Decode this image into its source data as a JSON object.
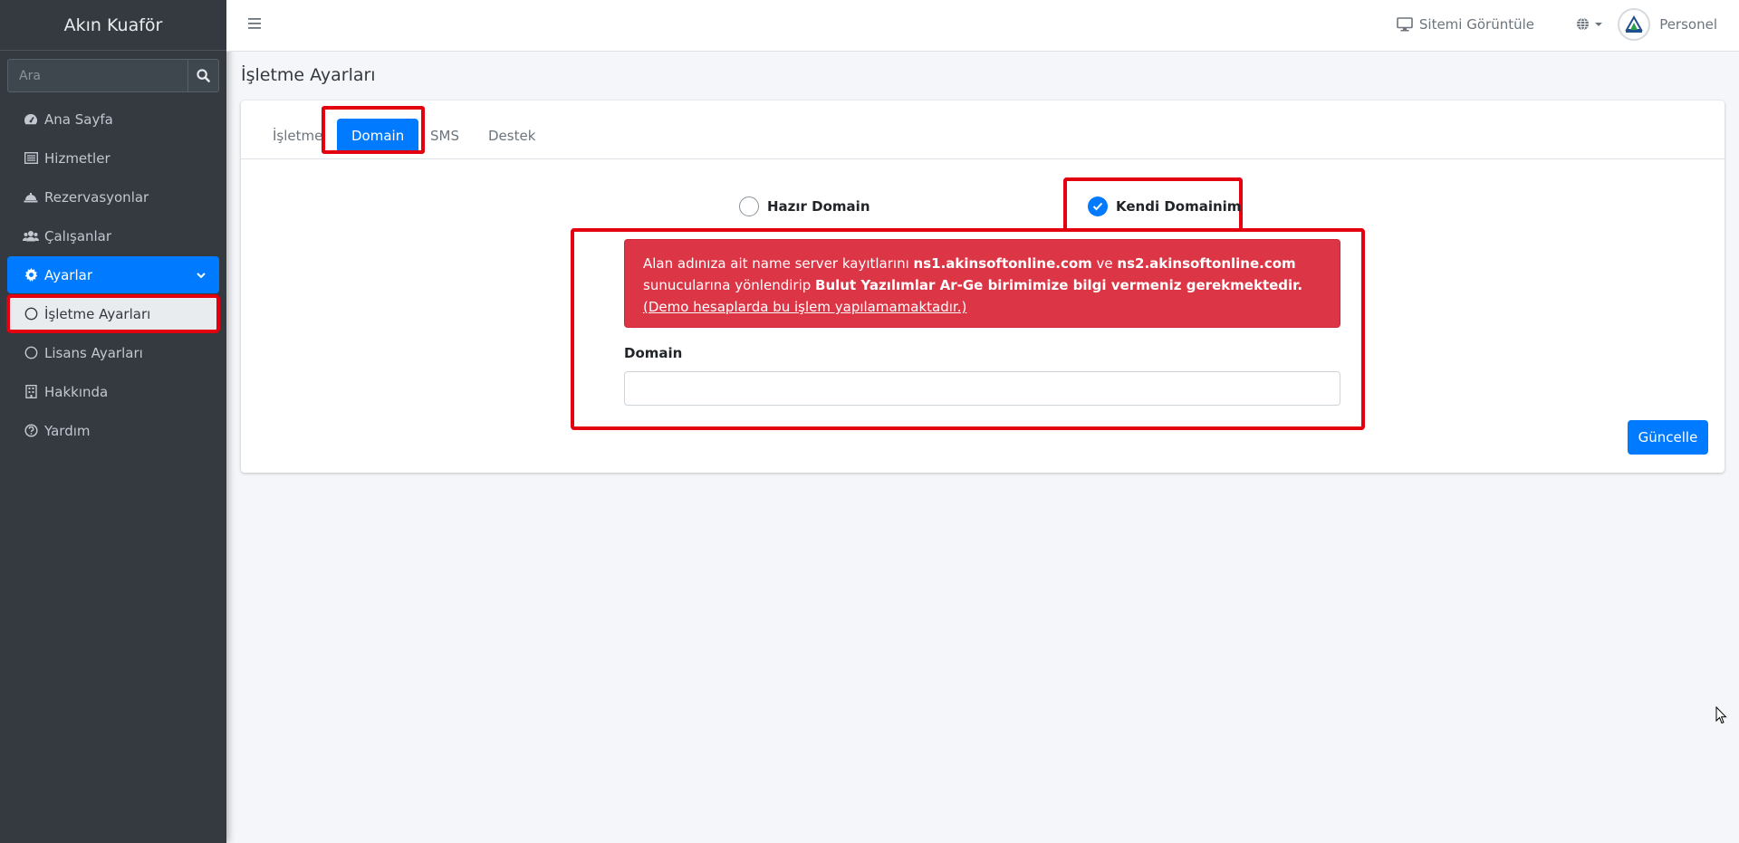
{
  "sidebar": {
    "brand": "Akın Kuaför",
    "search_placeholder": "Ara",
    "items": [
      {
        "label": "Ana Sayfa",
        "icon": "tachometer-icon"
      },
      {
        "label": "Hizmetler",
        "icon": "list-icon"
      },
      {
        "label": "Rezervasyonlar",
        "icon": "concierge-bell-icon"
      },
      {
        "label": "Çalışanlar",
        "icon": "users-icon"
      },
      {
        "label": "Ayarlar",
        "icon": "gear-icon",
        "active": true
      },
      {
        "label": "İşletme Ayarları",
        "icon": "circle-icon",
        "selected": true
      },
      {
        "label": "Lisans Ayarları",
        "icon": "circle-icon"
      },
      {
        "label": "Hakkında",
        "icon": "building-icon"
      },
      {
        "label": "Yardım",
        "icon": "question-circle-icon"
      }
    ]
  },
  "topbar": {
    "site_link": "Sitemi Görüntüle",
    "user": "Personel"
  },
  "page": {
    "title": "İşletme Ayarları"
  },
  "tabs": [
    {
      "label": "İşletme"
    },
    {
      "label": "Domain",
      "active": true
    },
    {
      "label": "SMS"
    },
    {
      "label": "Destek"
    }
  ],
  "domain_options": {
    "option1": "Hazır Domain",
    "option2": "Kendi Domainim",
    "selected": "option2"
  },
  "alert": {
    "part1": "Alan adınıza ait name server kayıtlarını ",
    "ns1": "ns1.akinsoftonline.com",
    "part2": " ve ",
    "ns2": "ns2.akinsoftonline.com",
    "part3": " sunucularına yönlendirip ",
    "bold_msg": "Bulut Yazılımlar Ar-Ge birimimize bilgi vermeniz gerekmektedir.",
    "demo_link": "(Demo hesaplarda bu işlem yapılamamaktadır.)"
  },
  "form": {
    "domain_label": "Domain",
    "domain_value": "",
    "update_button": "Güncelle"
  },
  "colors": {
    "primary": "#007bff",
    "danger": "#dc3545",
    "sidebar": "#343a40",
    "highlight": "#e3000f"
  }
}
